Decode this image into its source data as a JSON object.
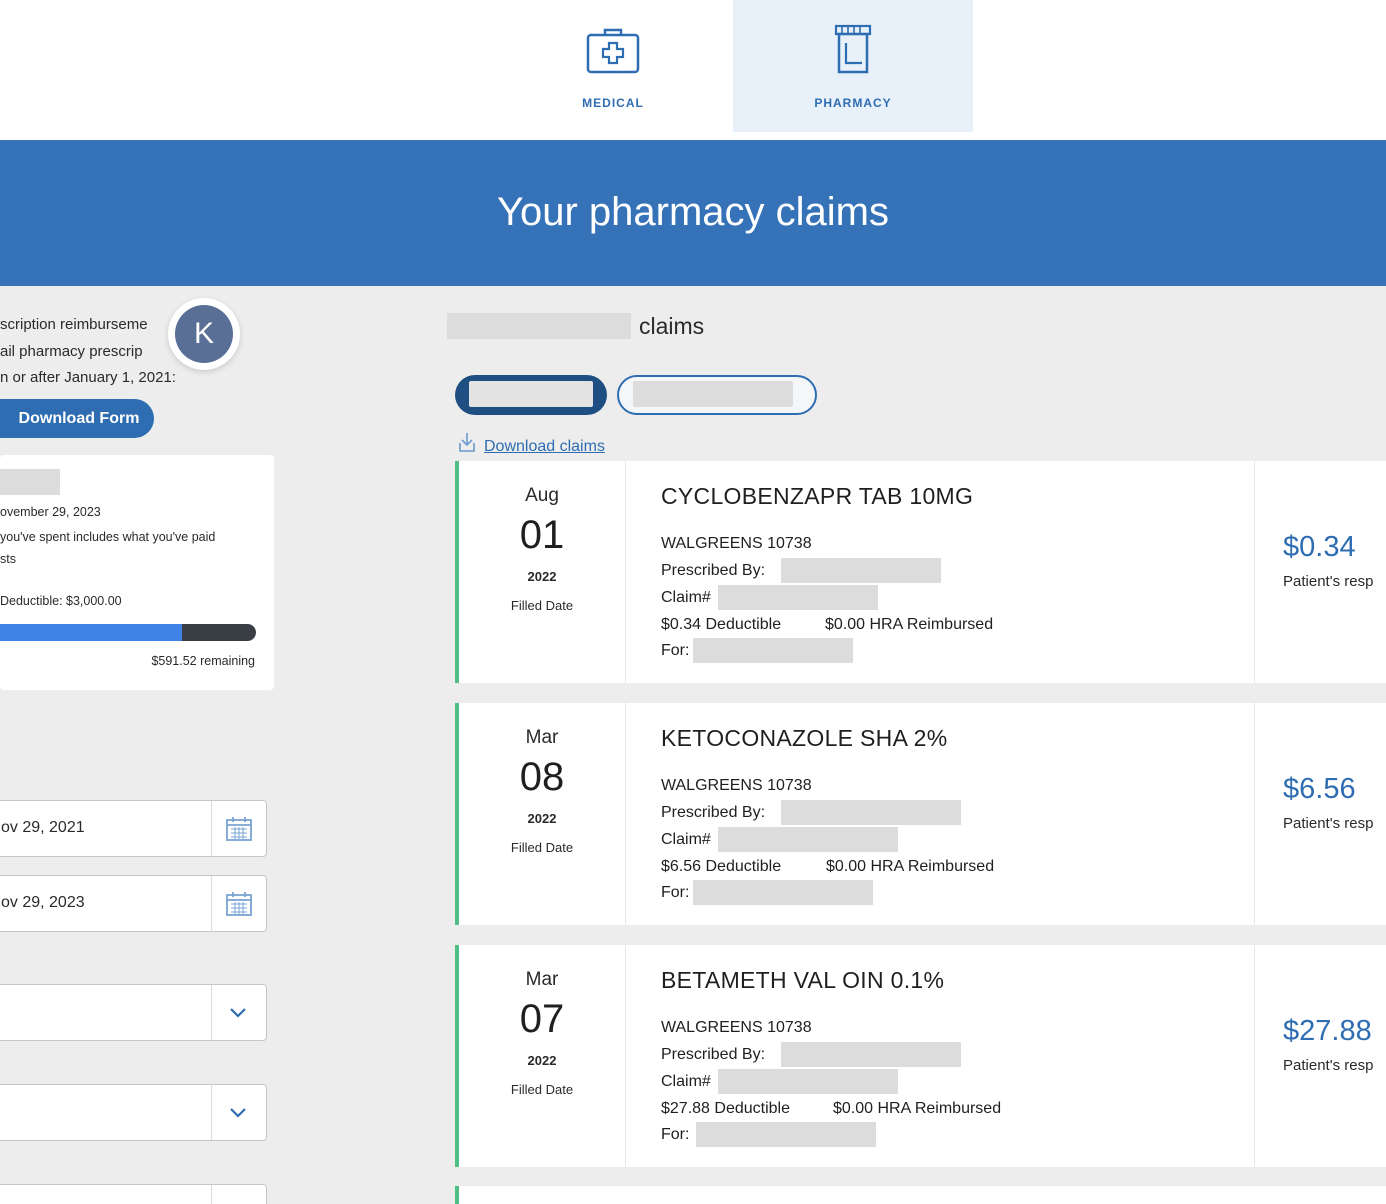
{
  "tabs": [
    {
      "label": "MEDICAL",
      "icon": "medical-kit-icon",
      "active": false
    },
    {
      "label": "PHARMACY",
      "icon": "pill-bottle-icon",
      "active": true
    }
  ],
  "banner": {
    "title": "Your pharmacy claims"
  },
  "sidebar": {
    "info_lines": [
      "scription reimburseme",
      "ail pharmacy prescrip",
      "n or after January 1, 2021:"
    ],
    "avatar_initial": "K",
    "download_form_label": "Download Form",
    "spend_card": {
      "as_of": "ovember 29, 2023",
      "note_line1": "you've spent includes what you've paid",
      "note_line2": "sts",
      "deductible_label": "Deductible: $3,000.00",
      "progress_fraction": 0.71,
      "remaining": "$591.52 remaining"
    },
    "start_date": "ov 29, 2021",
    "end_date": "ov 29, 2023"
  },
  "main": {
    "claims_label": "claims",
    "download_claims_label": "Download claims",
    "colors": {
      "accent": "#2f6db2",
      "banner": "#3572b8",
      "claim_border": "#4fbf85"
    },
    "claims": [
      {
        "month": "Aug",
        "day": "01",
        "year": "2022",
        "filled_label": "Filled Date",
        "drug": "CYCLOBENZAPR TAB 10MG",
        "pharmacy": "WALGREENS 10738",
        "prescribed_label": "Prescribed By:",
        "claim_label": "Claim#",
        "deductible": "$0.34 Deductible",
        "hra": "$0.00 HRA Reimbursed",
        "for_label": "For:",
        "amount": "$0.34",
        "amount_sub": "Patient's resp"
      },
      {
        "month": "Mar",
        "day": "08",
        "year": "2022",
        "filled_label": "Filled Date",
        "drug": "KETOCONAZOLE SHA 2%",
        "pharmacy": "WALGREENS 10738",
        "prescribed_label": "Prescribed By:",
        "claim_label": "Claim#",
        "deductible": "$6.56 Deductible",
        "hra": "$0.00 HRA Reimbursed",
        "for_label": "For:",
        "amount": "$6.56",
        "amount_sub": "Patient's resp"
      },
      {
        "month": "Mar",
        "day": "07",
        "year": "2022",
        "filled_label": "Filled Date",
        "drug": "BETAMETH VAL OIN 0.1%",
        "pharmacy": "WALGREENS 10738",
        "prescribed_label": "Prescribed By:",
        "claim_label": "Claim#",
        "deductible": "$27.88 Deductible",
        "hra": "$0.00 HRA Reimbursed",
        "for_label": "For:",
        "amount": "$27.88",
        "amount_sub": "Patient's resp"
      }
    ]
  }
}
